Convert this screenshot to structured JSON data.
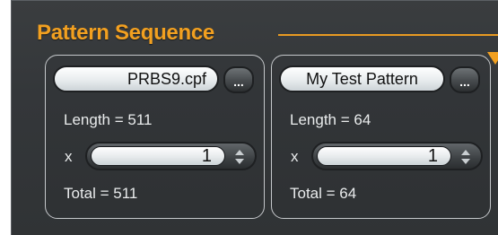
{
  "section": {
    "title": "Pattern Sequence"
  },
  "patterns": [
    {
      "file": "PRBS9.cpf",
      "browse_label": "...",
      "length_text": "Length = 511",
      "multiplier_label": "x",
      "multiplier_value": "1",
      "total_text": "Total = 511"
    },
    {
      "file": "My Test Pattern",
      "browse_label": "...",
      "length_text": "Length = 64",
      "multiplier_label": "x",
      "multiplier_value": "1",
      "total_text": "Total = 64"
    }
  ],
  "colors": {
    "accent": "#f2a020",
    "panel_bg": "#34373a",
    "card_border": "#c5c8cb",
    "text": "#e9ebec"
  },
  "icons": {
    "expand": "triangle-down-icon",
    "spinner": "up-down-arrows-icon"
  }
}
